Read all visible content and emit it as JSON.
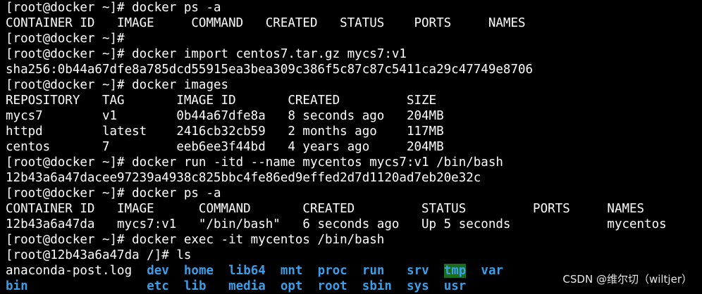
{
  "terminal": {
    "lines": [
      "[root@docker ~]# docker ps -a",
      "CONTAINER ID   IMAGE     COMMAND   CREATED   STATUS    PORTS     NAMES",
      "[root@docker ~]#",
      "[root@docker ~]# docker import centos7.tar.gz mycs7:v1",
      "sha256:0b44a67dfe8a785dcd55915ea3bea309c386f5c87c87c5411ca29c47749e8706",
      "[root@docker ~]# docker images",
      "REPOSITORY   TAG       IMAGE ID       CREATED         SIZE",
      "mycs7        v1        0b44a67dfe8a   8 seconds ago   204MB",
      "httpd        latest    2416cb32cb59   2 months ago    117MB",
      "centos       7         eeb6ee3f44bd   4 years ago     204MB",
      "[root@docker ~]# docker run -itd --name mycentos mycs7:v1 /bin/bash",
      "12b43a6a47dacee97239a4938c825bbc4fe86ed9effed2d7d1120ad7eb20e32c",
      "[root@docker ~]# docker ps -a",
      "CONTAINER ID   IMAGE      COMMAND       CREATED         STATUS         PORTS     NAMES",
      "12b43a6a47da   mycs7:v1   \"/bin/bash\"   6 seconds ago   Up 5 seconds             mycentos",
      "[root@docker ~]# docker exec -it mycentos /bin/bash",
      "[root@12b43a6a47da /]# ls"
    ],
    "ls_row1": [
      {
        "text": "anaconda-post.log",
        "type": "file",
        "pad": "  "
      },
      {
        "text": "dev",
        "type": "dir",
        "pad": "  "
      },
      {
        "text": "home",
        "type": "dir",
        "pad": "  "
      },
      {
        "text": "lib64",
        "type": "dir",
        "pad": "  "
      },
      {
        "text": "mnt",
        "type": "dir",
        "pad": "  "
      },
      {
        "text": "proc",
        "type": "dir",
        "pad": "  "
      },
      {
        "text": "run",
        "type": "dir",
        "pad": "   "
      },
      {
        "text": "srv",
        "type": "dir",
        "pad": "  "
      },
      {
        "text": "tmp",
        "type": "dir-hl",
        "pad": "  "
      },
      {
        "text": "var",
        "type": "dir",
        "pad": ""
      }
    ],
    "ls_row2": [
      {
        "text": "bin",
        "type": "dir",
        "pad": "                "
      },
      {
        "text": "etc",
        "type": "dir",
        "pad": "  "
      },
      {
        "text": "lib",
        "type": "dir",
        "pad": "   "
      },
      {
        "text": "media",
        "type": "dir",
        "pad": "  "
      },
      {
        "text": "opt",
        "type": "dir",
        "pad": "  "
      },
      {
        "text": "root",
        "type": "dir",
        "pad": "  "
      },
      {
        "text": "sbin",
        "type": "dir",
        "pad": "  "
      },
      {
        "text": "sys",
        "type": "dir",
        "pad": "  "
      },
      {
        "text": "usr",
        "type": "dir",
        "pad": ""
      }
    ]
  },
  "watermark": "CSDN @维尔切（wiltjer）",
  "colors": {
    "background": "#000000",
    "text": "#ffffff",
    "directory": "#3a9ee8",
    "sticky_dir_bg": "#1b6d1b"
  }
}
